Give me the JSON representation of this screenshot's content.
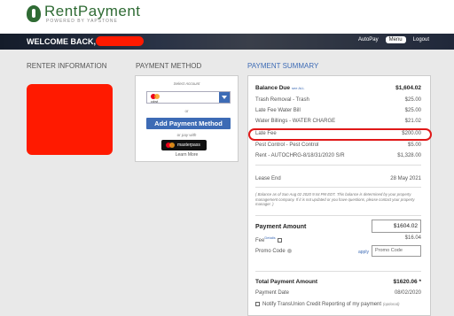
{
  "header": {
    "brand": "RentPayment",
    "tagline": "POWERED BY YAPSTONE"
  },
  "nav": {
    "welcome": "WELCOME BACK,",
    "links": [
      "AutoPay",
      "Menu",
      "Logout"
    ]
  },
  "sections": {
    "renter_info": "RENTER INFORMATION",
    "payment_method": "PAYMENT METHOD",
    "payment_summary": "PAYMENT SUMMARY"
  },
  "payment_method": {
    "select_label": "Select Account",
    "card_name": "cdwt",
    "or_label": "or",
    "add_button": "Add Payment Method",
    "or_pay_with": "or pay with",
    "masterpass": "masterpass",
    "learn_more": "Learn More"
  },
  "summary": {
    "balance_label": "Balance Due",
    "see_all": "see ALL",
    "balance_value": "$1,604.02",
    "items": [
      {
        "label": "Trash Removal - Trash",
        "value": "$25.00"
      },
      {
        "label": "Late Fee Water Bill",
        "value": "$25.00"
      },
      {
        "label": "Water Billings - WATER CHARGE",
        "value": "$21.02"
      },
      {
        "label": "Late Fee",
        "value": "$200.00"
      },
      {
        "label": "Pest Control - Pest Control",
        "value": "$5.00"
      },
      {
        "label": "Rent - AUTOCHRG-8/18/31/2020 S/R",
        "value": "$1,328.00"
      }
    ],
    "lease_end_label": "Lease End",
    "lease_end_value": "28 May 2021",
    "note": "( Balance as of Sun Aug 02 2020 9:44 PM EDT. This balance is determined by your property management company. If it is not updated or you have questions, please contact your property manager. )",
    "payment_amount_label": "Payment Amount",
    "payment_amount_value": "$1604.02",
    "fee_label": "Fee",
    "fee_details": "Details",
    "fee_value": "$16.04",
    "promo_label": "Promo Code",
    "apply": "apply",
    "promo_placeholder": "Promo Code",
    "total_label": "Total Payment Amount",
    "total_value": "$1620.06 *",
    "payment_date_label": "Payment Date",
    "payment_date_value": "08/02/2020",
    "transunion_label": "Notify TransUnion Credit Reporting of my payment",
    "transunion_optional": "(optional)"
  },
  "colors": {
    "brand_green": "#2f6b34",
    "accent_blue": "#3d6bb5",
    "annotation_red": "#e01818",
    "redaction": "#ff1a00"
  }
}
